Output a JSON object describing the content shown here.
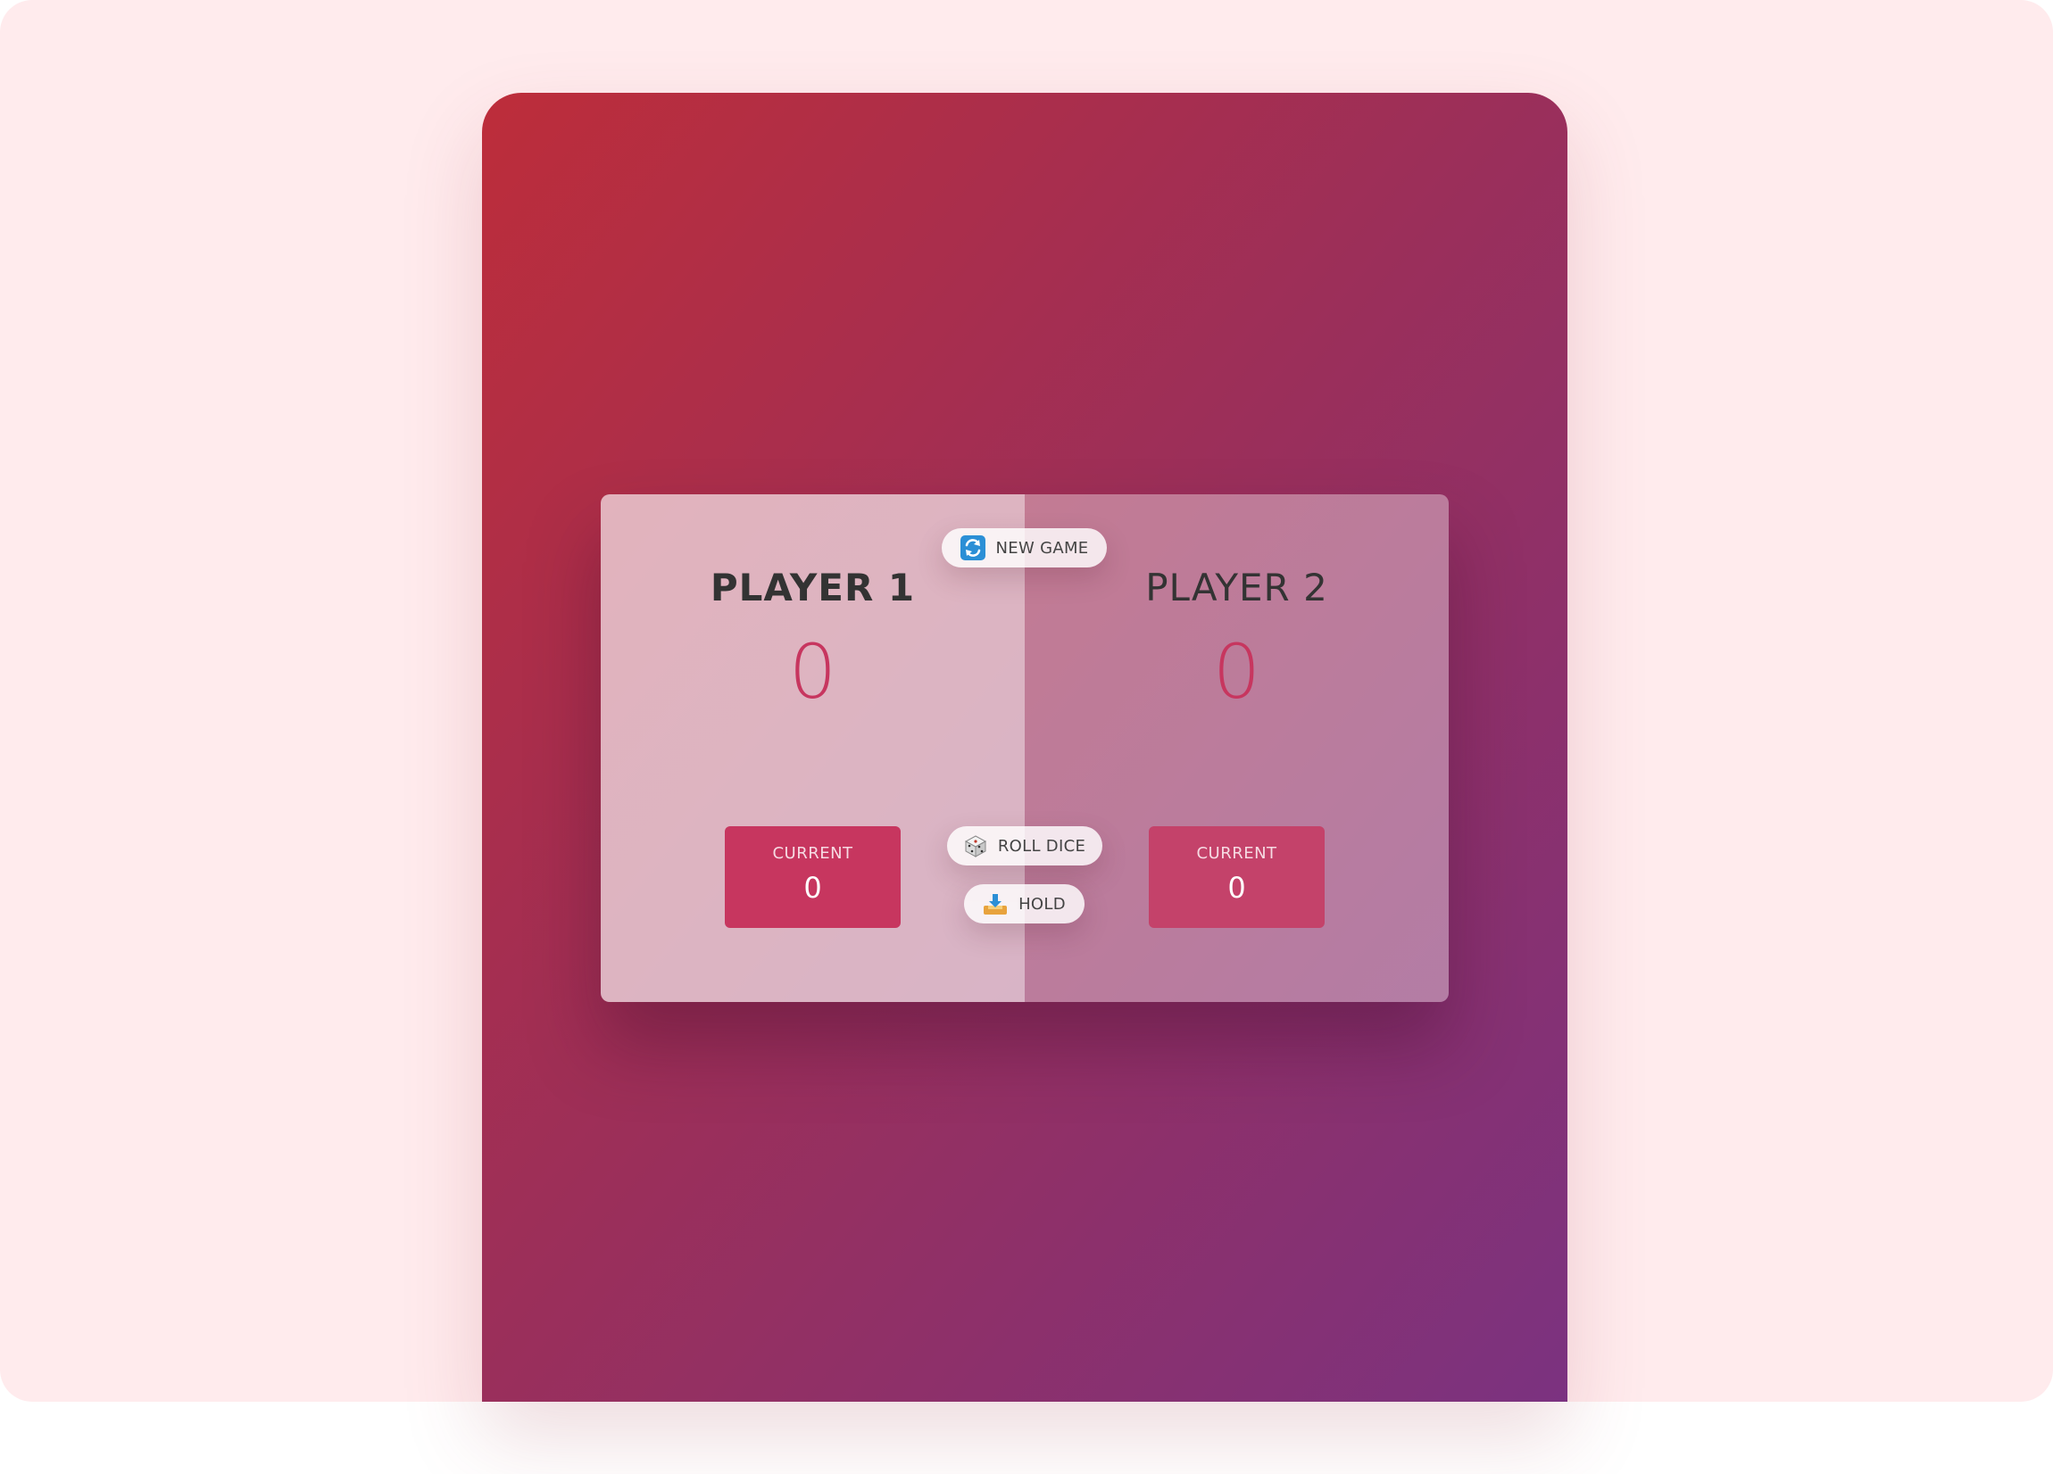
{
  "players": [
    {
      "name": "PLAYER 1",
      "score": "0",
      "current_label": "CURRENT",
      "current_score": "0",
      "active": true
    },
    {
      "name": "PLAYER 2",
      "score": "0",
      "current_label": "CURRENT",
      "current_score": "0",
      "active": false
    }
  ],
  "buttons": {
    "new_game": {
      "label": "NEW GAME",
      "icon": "refresh-icon"
    },
    "roll_dice": {
      "label": "ROLL DICE",
      "icon": "dice-icon"
    },
    "hold": {
      "label": "HOLD",
      "icon": "inbox-tray-icon"
    }
  },
  "colors": {
    "accent": "#c7365f",
    "gradient_start": "#bd2d3a",
    "gradient_end": "#7b3280",
    "page_background": "#ffebed"
  }
}
